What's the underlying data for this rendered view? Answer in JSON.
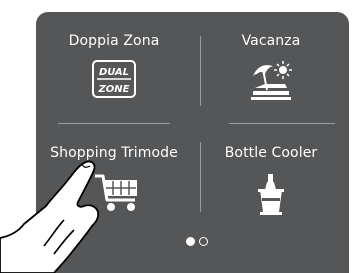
{
  "screen": {
    "colors": {
      "panel_bg": "#555657",
      "text": "#ffffff",
      "divider": "#9a9b9c"
    }
  },
  "tiles": [
    {
      "label": "Doppia Zona",
      "icon": "dual-zone-icon",
      "icon_text_line1": "DUAL",
      "icon_text_line2": "ZONE"
    },
    {
      "label": "Vacanza",
      "icon": "vacation-icon"
    },
    {
      "label": "Shopping Trimode",
      "icon": "shopping-cart-icon"
    },
    {
      "label": "Bottle Cooler",
      "icon": "bottle-cooler-icon"
    }
  ],
  "pager": {
    "current_page": 1,
    "total_pages": 2
  }
}
